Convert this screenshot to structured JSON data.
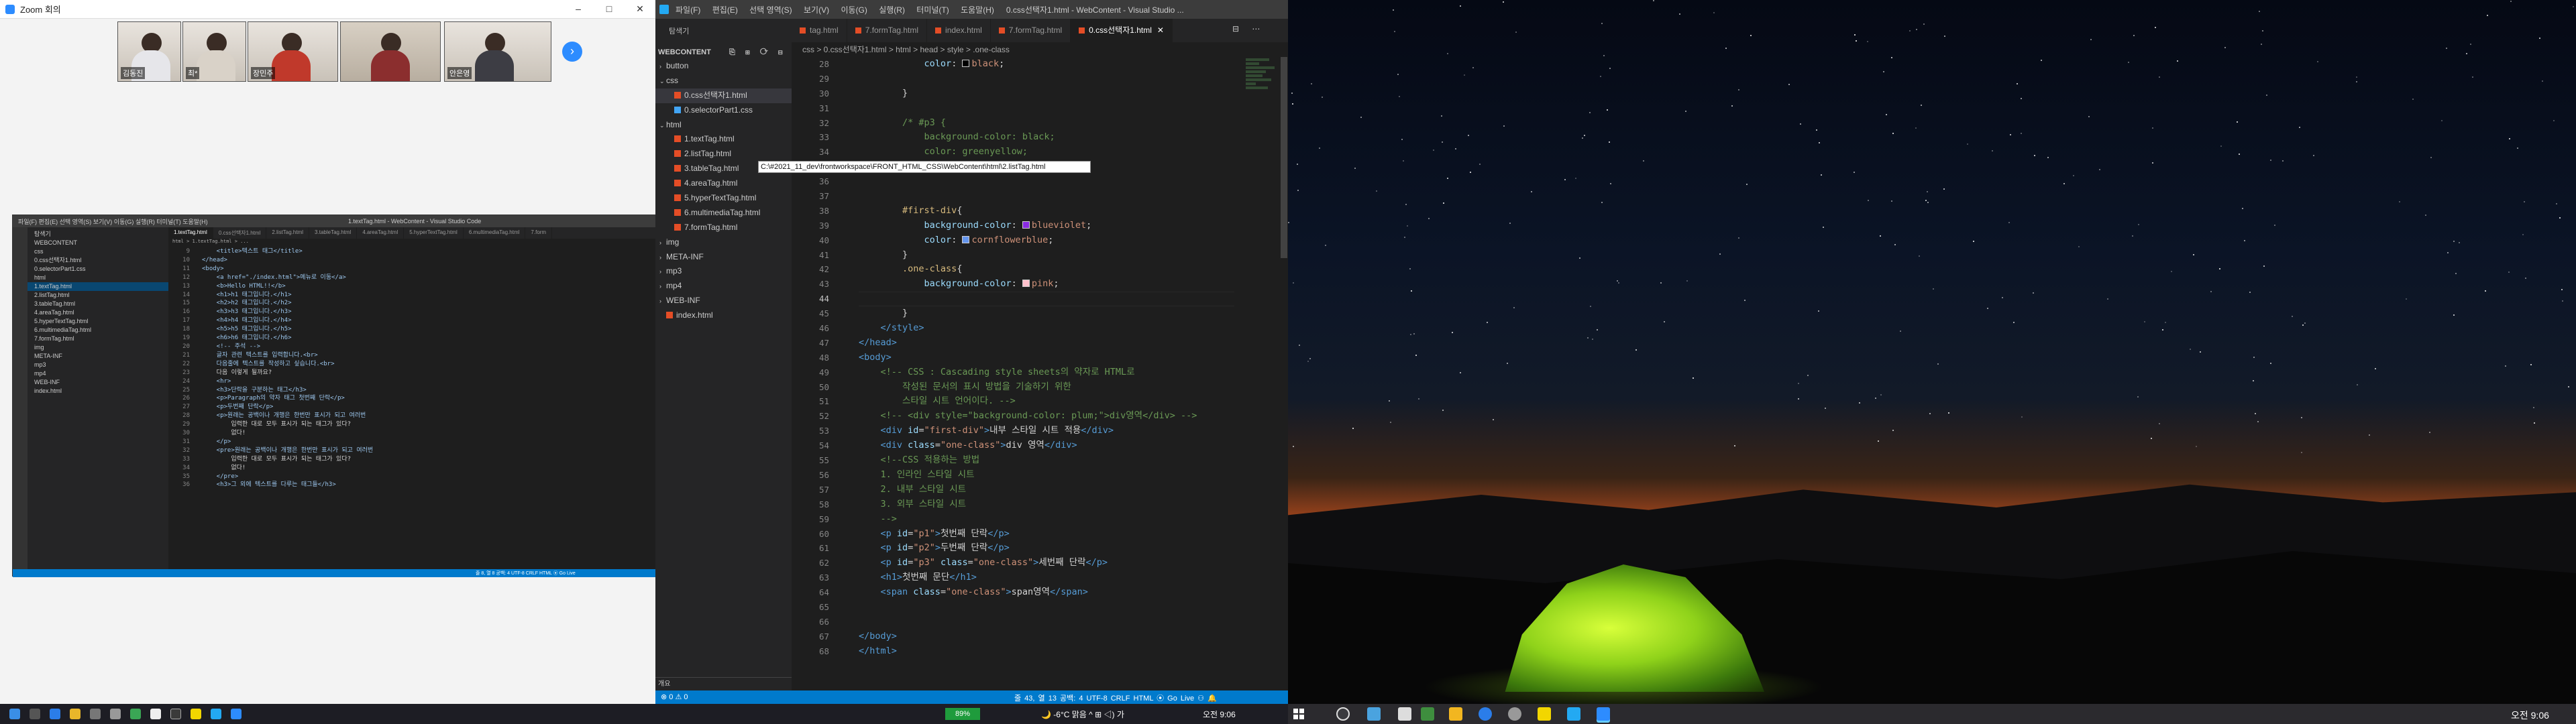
{
  "zoom": {
    "title": "Zoom 회의",
    "window_buttons": [
      "–",
      "□",
      "✕"
    ],
    "participants": [
      {
        "name": "김동진",
        "shirt": "#e6e6ea"
      },
      {
        "name": "최*",
        "shirt": "#d9d2c8"
      },
      {
        "name": "장민주",
        "shirt": "#c0392b"
      },
      {
        "name": "안은영",
        "shirt": "#3d3d44"
      }
    ],
    "next_arrow": "›"
  },
  "mini_vscode": {
    "menu": "파일(F)  편집(E)  선택 영역(S)  보기(V)  이동(G)  실행(R)  터미널(T)  도움말(H)",
    "title": "1.textTag.html - WebContent - Visual Studio Code",
    "sidebar_rows": [
      "탐색기",
      "WEBCONTENT",
      "css",
      "0.css선택자1.html",
      "0.selectorPart1.css",
      "html",
      "1.textTag.html",
      "2.listTag.html",
      "3.tableTag.html",
      "4.areaTag.html",
      "5.hyperTextTag.html",
      "6.multimediaTag.html",
      "7.formTag.html",
      "img",
      "META-INF",
      "mp3",
      "mp4",
      "WEB-INF",
      "index.html"
    ],
    "tabs": [
      "1.textTag.html",
      "0.css선택자1.html",
      "2.listTag.html",
      "3.tableTag.html",
      "4.areaTag.html",
      "5.hyperTextTag.html",
      "6.multimediaTag.html",
      "7.form"
    ],
    "breadcrumb": "html > 1.textTag.html > ...",
    "code": [
      {
        "n": "9",
        "t": "    <title>텍스트 태그</title>"
      },
      {
        "n": "10",
        "t": "</head>"
      },
      {
        "n": "11",
        "t": "<body>"
      },
      {
        "n": "12",
        "t": "    <a href=\"./index.html\">메뉴로 이동</a>"
      },
      {
        "n": "13",
        "t": "    <b>Hello HTML!!</b>"
      },
      {
        "n": "14",
        "t": "    <h1>h1 태그입니다.</h1>"
      },
      {
        "n": "15",
        "t": "    <h2>h2 태그입니다.</h2>"
      },
      {
        "n": "16",
        "t": "    <h3>h3 태그입니다.</h3>"
      },
      {
        "n": "17",
        "t": "    <h4>h4 태그입니다.</h4>"
      },
      {
        "n": "18",
        "t": "    <h5>h5 태그입니다.</h5>"
      },
      {
        "n": "19",
        "t": "    <h6>h6 태그입니다.</h6>"
      },
      {
        "n": "20",
        "t": "    <!-- 주석 -->"
      },
      {
        "n": "21",
        "t": "    글자 관련 텍스트를 입력합니다.<br>"
      },
      {
        "n": "22",
        "t": "    다음줄에 텍스트를 작성하고 싶습니다.<br>"
      },
      {
        "n": "23",
        "t": "    다음 이렇게 될까요?"
      },
      {
        "n": "24",
        "t": "    <hr>"
      },
      {
        "n": "25",
        "t": "    <h3>단락을 구분하는 태그</h3>"
      },
      {
        "n": "26",
        "t": "    <p>Paragraph의 약자 태그 첫번째 단락</p>"
      },
      {
        "n": "27",
        "t": "    <p>두번째 단락</p>"
      },
      {
        "n": "28",
        "t": "    <p>원래는 공백이나 개행은 한번만 표시가 되고 여러번"
      },
      {
        "n": "29",
        "t": "        입력한 대로 모두 표시가 되는 태그가 있다?"
      },
      {
        "n": "30",
        "t": "        없다!"
      },
      {
        "n": "31",
        "t": "    </p>"
      },
      {
        "n": "32",
        "t": "    <pre>원래는 공백이나 개행은 한번만 표시가 되고 여러번"
      },
      {
        "n": "33",
        "t": "        입력한 대로 모두 표시가 되는 태그가 있다?"
      },
      {
        "n": "34",
        "t": "        없다!"
      },
      {
        "n": "35",
        "t": "    </pre>"
      },
      {
        "n": "36",
        "t": "    <h3>그 외에 텍스트를 다루는 태그들</h3>"
      }
    ],
    "status": "줄 8, 열 8  공백: 4  UTF-8  CRLF  HTML  ⦿ Go Live"
  },
  "vscode": {
    "menu": [
      "파일(F)",
      "편집(E)",
      "선택 영역(S)",
      "보기(V)",
      "이동(G)",
      "실행(R)",
      "터미널(T)",
      "도움말(H)"
    ],
    "window_title": "0.css선택자1.html - WebContent - Visual Studio ...",
    "explorer_header": "탐색기",
    "explorer_actions": "⎘ ⊞ ⟳ ⊟",
    "project": "WEBCONTENT",
    "tree": [
      {
        "label": "button",
        "type": "folder",
        "depth": 0,
        "open": false
      },
      {
        "label": "css",
        "type": "folder",
        "depth": 0,
        "open": true
      },
      {
        "label": "0.css선택자1.html",
        "type": "html",
        "depth": 1,
        "selected": true
      },
      {
        "label": "0.selectorPart1.css",
        "type": "css",
        "depth": 1
      },
      {
        "label": "html",
        "type": "folder",
        "depth": 0,
        "open": true
      },
      {
        "label": "1.textTag.html",
        "type": "html",
        "depth": 1
      },
      {
        "label": "2.listTag.html",
        "type": "html",
        "depth": 1
      },
      {
        "label": "3.tableTag.html",
        "type": "html",
        "depth": 1
      },
      {
        "label": "4.areaTag.html",
        "type": "html",
        "depth": 1
      },
      {
        "label": "5.hyperTextTag.html",
        "type": "html",
        "depth": 1
      },
      {
        "label": "6.multimediaTag.html",
        "type": "html",
        "depth": 1
      },
      {
        "label": "7.formTag.html",
        "type": "html",
        "depth": 1
      },
      {
        "label": "img",
        "type": "folder",
        "depth": 0,
        "open": false
      },
      {
        "label": "META-INF",
        "type": "folder",
        "depth": 0,
        "open": false
      },
      {
        "label": "mp3",
        "type": "folder",
        "depth": 0,
        "open": false
      },
      {
        "label": "mp4",
        "type": "folder",
        "depth": 0,
        "open": false
      },
      {
        "label": "WEB-INF",
        "type": "folder",
        "depth": 0,
        "open": false
      },
      {
        "label": "index.html",
        "type": "html",
        "depth": 0
      }
    ],
    "outline": "개요",
    "tabs": [
      {
        "label": "tag.html",
        "active": false
      },
      {
        "label": "7.formTag.html",
        "active": false
      },
      {
        "label": "index.html",
        "active": false
      },
      {
        "label": "7.formTag.html",
        "active": false
      },
      {
        "label": "0.css선택자1.html",
        "active": true
      }
    ],
    "tab_close": "✕",
    "tab_tools": "⊟ ⋯",
    "breadcrumb": "css > 0.css선택자1.html > html > head > style > .one-class",
    "hover_path": "C:\\#2021_11_dev\\frontworkspace\\FRONT_HTML_CSS\\WebContent\\html\\2.listTag.html",
    "code_lines": [
      {
        "n": "28",
        "html": "            <span class='c-prop'>color</span>: <span class='sw' style='background:#000'></span><span class='c-val'>black</span>;"
      },
      {
        "n": "29",
        "html": "        "
      },
      {
        "n": "30",
        "html": "        }"
      },
      {
        "n": "31",
        "html": ""
      },
      {
        "n": "32",
        "html": "        <span class='c-com'>/* #p3 {</span>"
      },
      {
        "n": "33",
        "html": "<span class='c-com'>            background-color: black;</span>"
      },
      {
        "n": "34",
        "html": "<span class='c-com'>            color: greenyellow;</span>"
      },
      {
        "n": "35",
        "html": ""
      },
      {
        "n": "36",
        "html": ""
      },
      {
        "n": "37",
        "html": ""
      },
      {
        "n": "38",
        "html": "        <span class='c-sel'>#first-div</span>{"
      },
      {
        "n": "39",
        "html": "            <span class='c-prop'>background-color</span>: <span class='sw' style='background:#8a2be2'></span><span class='c-val'>blueviolet</span>;"
      },
      {
        "n": "40",
        "html": "            <span class='c-prop'>color</span>: <span class='sw' style='background:#6495ed'></span><span class='c-val'>cornflowerblue</span>;"
      },
      {
        "n": "41",
        "html": "        }"
      },
      {
        "n": "42",
        "html": "        <span class='c-sel'>.one-class</span>{"
      },
      {
        "n": "43",
        "html": "            <span class='c-prop'>background-color</span>: <span class='sw' style='background:#ffc0cb'></span><span class='c-val'>pink</span>;"
      },
      {
        "n": "44",
        "html": "        "
      },
      {
        "n": "45",
        "html": "        }"
      },
      {
        "n": "46",
        "html": "    <span class='c-tag'>&lt;/style&gt;</span>"
      },
      {
        "n": "47",
        "html": "<span class='c-tag'>&lt;/head&gt;</span>"
      },
      {
        "n": "48",
        "html": "<span class='c-tag'>&lt;body&gt;</span>"
      },
      {
        "n": "49",
        "html": "    <span class='c-com'>&lt;!-- CSS : Cascading style sheets의 약자로 HTML로</span>"
      },
      {
        "n": "50",
        "html": "<span class='c-com'>        작성된 문서의 표시 방법을 기술하기 위한</span>"
      },
      {
        "n": "51",
        "html": "<span class='c-com'>        스타일 시트 언어이다. --&gt;</span>"
      },
      {
        "n": "52",
        "html": "    <span class='c-com'>&lt;!-- &lt;div style=\"background-color: plum;\"&gt;div영역&lt;/div&gt; --&gt;</span>"
      },
      {
        "n": "53",
        "html": "    <span class='c-tag'>&lt;div</span> <span class='c-at'>id</span>=<span class='c-str'>\"first-div\"</span><span class='c-tag'>&gt;</span>내부 스타일 시트 적용<span class='c-tag'>&lt;/div&gt;</span>"
      },
      {
        "n": "54",
        "html": "    <span class='c-tag'>&lt;div</span> <span class='c-at'>class</span>=<span class='c-str'>\"one-class\"</span><span class='c-tag'>&gt;</span>div 영역<span class='c-tag'>&lt;/div&gt;</span>"
      },
      {
        "n": "55",
        "html": "    <span class='c-com'>&lt;!--CSS 적용하는 방법</span>"
      },
      {
        "n": "56",
        "html": "<span class='c-com'>    1. 인라인 스타일 시트</span>"
      },
      {
        "n": "57",
        "html": "<span class='c-com'>    2. 내부 스타일 시트</span>"
      },
      {
        "n": "58",
        "html": "<span class='c-com'>    3. 외부 스타일 시트</span>"
      },
      {
        "n": "59",
        "html": "<span class='c-com'>    --&gt;</span>"
      },
      {
        "n": "60",
        "html": "    <span class='c-tag'>&lt;p</span> <span class='c-at'>id</span>=<span class='c-str'>\"p1\"</span><span class='c-tag'>&gt;</span>첫번째 단락<span class='c-tag'>&lt;/p&gt;</span>"
      },
      {
        "n": "61",
        "html": "    <span class='c-tag'>&lt;p</span> <span class='c-at'>id</span>=<span class='c-str'>\"p2\"</span><span class='c-tag'>&gt;</span>두번째 단락<span class='c-tag'>&lt;/p&gt;</span>"
      },
      {
        "n": "62",
        "html": "    <span class='c-tag'>&lt;p</span> <span class='c-at'>id</span>=<span class='c-str'>\"p3\"</span> <span class='c-at'>class</span>=<span class='c-str'>\"one-class\"</span><span class='c-tag'>&gt;</span>세번째 단락<span class='c-tag'>&lt;/p&gt;</span>"
      },
      {
        "n": "63",
        "html": "    <span class='c-tag'>&lt;h1&gt;</span>첫번째 문단<span class='c-tag'>&lt;/h1&gt;</span>"
      },
      {
        "n": "64",
        "html": "    <span class='c-tag'>&lt;span</span> <span class='c-at'>class</span>=<span class='c-str'>\"one-class\"</span><span class='c-tag'>&gt;</span>span영역<span class='c-tag'>&lt;/span&gt;</span>"
      },
      {
        "n": "65",
        "html": ""
      },
      {
        "n": "66",
        "html": ""
      },
      {
        "n": "67",
        "html": "<span class='c-tag'>&lt;/body&gt;</span>"
      },
      {
        "n": "68",
        "html": "<span class='c-tag'>&lt;/html&gt;</span>"
      }
    ],
    "current_line": "44",
    "status_left": "⊗ 0  ⚠ 0",
    "status_right": "줄 43, 열 13   공백: 4   UTF-8   CRLF   HTML   ⦿ Go Live   ⚇   🔔"
  },
  "taskbar_mid": {
    "battery": "89%",
    "weather": "🌙 -6°C 맑음  ^  ⊞  ◁)  가",
    "clock": "오전 9:06"
  },
  "taskbar_right": {
    "clock": "오전 9:06"
  },
  "colors": {
    "vscode_blue": "#007acc",
    "zoom_blue": "#2d8cff",
    "editor_bg": "#1e1e1e",
    "sidebar_bg": "#252526"
  }
}
